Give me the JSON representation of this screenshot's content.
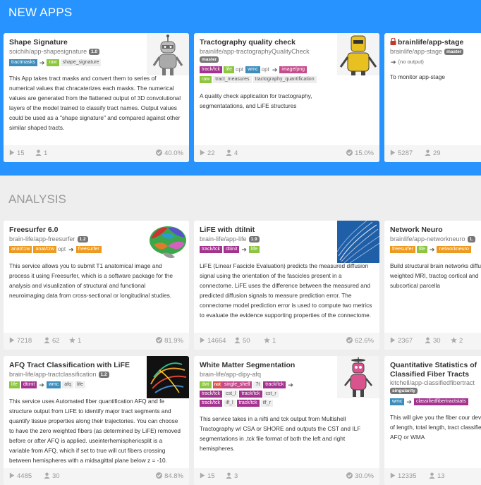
{
  "sections": {
    "new_apps": "NEW APPS",
    "analysis": "ANALYSIS"
  },
  "cards": {
    "shape": {
      "title": "Shape Signature",
      "repo": "soichih/app-shapesignature",
      "version": "1.0",
      "tags": {
        "in1": "tractmasks",
        "out1": "raw",
        "out2": "shape_signature"
      },
      "desc": "This App takes tract masks and convert them to series of numerical values that chracaterizes each masks. The numerical values are generated from the flattened output of 3D convolutional layers of the model trained to classify tract names. Output values could be used as a \"shape signature\" and compared against other similar shaped tracts.",
      "stats": {
        "runs": "15",
        "users": "1",
        "success": "40.0%"
      }
    },
    "tractography": {
      "title": "Tractography quality check",
      "repo": "brainlife/app-tractographyQualityCheck",
      "branch": "master",
      "tags": {
        "in1": "track/tck",
        "in2": "life",
        "opt1": "opt",
        "in3": "wmc",
        "opt2": "opt",
        "out1": "image/png",
        "out2": "raw",
        "out3": "tract_measures",
        "out4": "tractography_quantification"
      },
      "desc": "A quality check application for tractography, segmentatations, and LiFE structures",
      "stats": {
        "runs": "22",
        "users": "4",
        "success": "15.0%"
      }
    },
    "stage": {
      "title": "brainlife/app-stage",
      "repo": "brainlife/app-stage",
      "branch": "master",
      "no_output": "(no output)",
      "desc": "To monitor app-stage",
      "stats": {
        "runs": "5287",
        "users": "29"
      }
    },
    "freesurfer": {
      "title": "Freesurfer 6.0",
      "repo": "brain-life/app-freesurfer",
      "version": "1.2",
      "tags": {
        "in1": "anat/t1w",
        "in2": "anat/t2w",
        "opt": "opt",
        "out1": "freesurfer"
      },
      "desc": "This service allows you to submit T1 anatomical image and process it using Freesurfer, which is a software package for the analysis and visualization of structural and functional neuroimaging data from cross-sectional or longitudinal studies.",
      "stats": {
        "runs": "7218",
        "users": "62",
        "stars": "1",
        "success": "81.9%"
      }
    },
    "life": {
      "title": "LiFE with dtiInit",
      "repo": "brain-life/app-life",
      "version": "1.9",
      "tags": {
        "in1": "track/tck",
        "in2": "dtiinit",
        "out1": "life"
      },
      "desc": "LiFE (Linear Fascicle Evaluation) predicts the measured diffusion signal using the orientation of the fascicles present in a connectome. LiFE uses the difference between the measured and predicted diffusion signals to measure prediction error. The connectome model prediction error is used to compute two metrics to evaluate the evidence supporting properties of the connectome.",
      "stats": {
        "runs": "14664",
        "users": "50",
        "stars": "1",
        "success": "62.6%"
      }
    },
    "networkneuro": {
      "title": "Network Neuro",
      "repo": "brainlife/app-networkneuro",
      "version": "1.",
      "tags": {
        "in1": "freesurfer",
        "in2": "life",
        "out1": "networkneuro"
      },
      "desc": "Build structural brain networks diffusion-weighted MRI, tractog cortical and subcortical parcella",
      "stats": {
        "runs": "2367",
        "users": "30",
        "stars": "2"
      }
    },
    "afq": {
      "title": "AFQ Tract Classification with LiFE",
      "repo": "brain-life/app-tractclassification",
      "version": "1.2",
      "tags": {
        "in1": "life",
        "in2": "dtiinit",
        "out1": "wmc",
        "out2": "afq",
        "out3": "life"
      },
      "desc": "This service uses Automated fiber quantification AFQ and fe structure output from LiFE to identify major tract segments and quantify tissue properties along their trajectories. You can choose to have the zero weighted fibers (as determined by LiFE) removed before or after AFQ is applied. useinterhemisphericsplit is a variable from AFQ, which if set to true will cut fibers crossing between hemispheres with a midsagittal plane below z = -10.",
      "stats": {
        "runs": "4485",
        "users": "30",
        "success": "84.8%"
      }
    },
    "wmseg": {
      "title": "White Matter Segmentation",
      "repo": "brain-life/app-dipy-afq",
      "tags": {
        "in1": "dwi",
        "not": "not",
        "in2": "single_shell",
        "in3": "7t",
        "in4": "track/tck",
        "out1": "track/tck",
        "out2": "cst_l",
        "out3": "track/tck",
        "out4": "cst_r",
        "out5": "track/tck",
        "out6": "ilf_l",
        "out7": "track/tck",
        "out8": "ilf_r"
      },
      "desc": "This service takes in a nifti and tck output from Multishell Tractography w/ CSA or SHORE and outputs the CST and ILF segmentations in .tck file format of both the left and right hemispheres.",
      "stats": {
        "runs": "15",
        "users": "3",
        "success": "30.0%"
      }
    },
    "quant": {
      "title1": "Quantitative Statistics of",
      "title2": "Classified Fiber Tracts",
      "repo": "kitchell/app-classifiedfibertract",
      "badge": "singularity",
      "tags": {
        "in1": "wmc",
        "out1": "classifiedfibertractstats"
      },
      "desc": "This will give you the fiber cour deviation of length, total length, tract classified by AFQ or WMA",
      "stats": {
        "runs": "12335",
        "users": "13"
      }
    }
  }
}
